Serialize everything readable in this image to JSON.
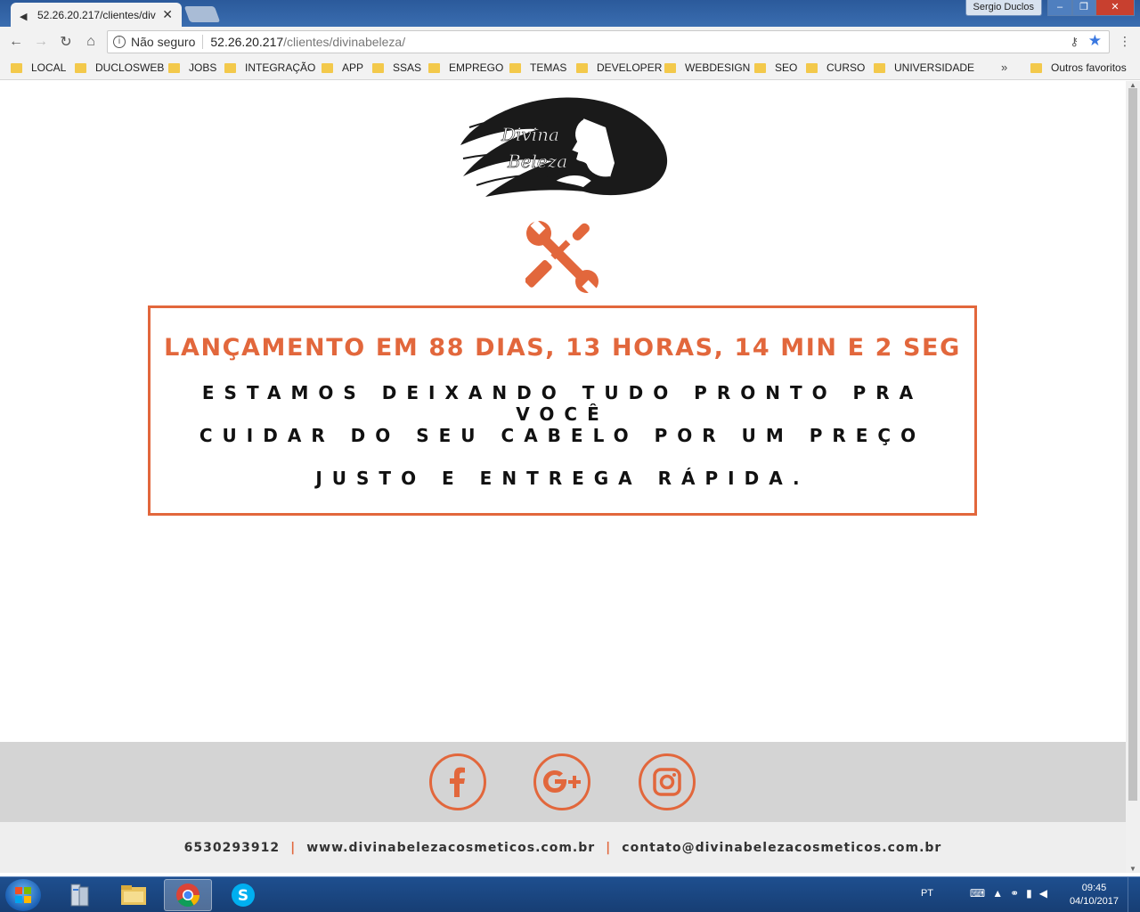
{
  "browser": {
    "tab": {
      "title": "52.26.20.217/clientes/div"
    },
    "user": "Sergio Duclos",
    "omnibox": {
      "security": "Não seguro",
      "host": "52.26.20.217",
      "path": "/clientes/divinabeleza/"
    },
    "bookmarks": [
      "LOCAL",
      "DUCLOSWEB",
      "JOBS",
      "INTEGRAÇÃO",
      "APP",
      "SSAS",
      "EMPREGO",
      "TEMAS",
      "DEVELOPER",
      "WEBDESIGN",
      "SEO",
      "CURSO",
      "UNIVERSIDADE"
    ],
    "more": "»",
    "other_bookmarks": "Outros favoritos"
  },
  "page": {
    "logo_line1": "Divina",
    "logo_line2": "Beleza",
    "countdown": "LANÇAMENTO EM 88 DIAS, 13 HORAS, 14 MIN E 2 SEG",
    "message_lines": [
      "ESTAMOS DEIXANDO TUDO PRONTO PRA VOCÊ",
      "CUIDAR DO SEU CABELO POR UM PREÇO",
      "JUSTO E ENTREGA RÁPIDA."
    ],
    "footer": {
      "phone": "6530293912",
      "website": "www.divinabelezacosmeticos.com.br",
      "email": "contato@divinabelezacosmeticos.com.br"
    },
    "accent_color": "#e2673c"
  },
  "taskbar": {
    "language": "PT",
    "time": "09:45",
    "date": "04/10/2017"
  }
}
